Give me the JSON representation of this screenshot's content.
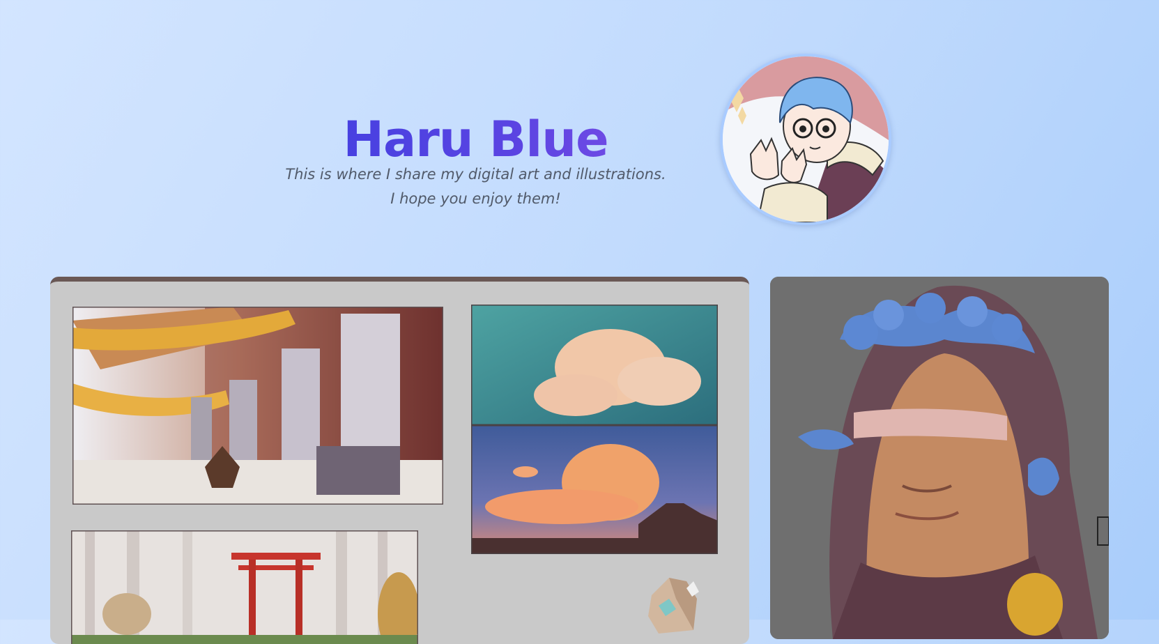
{
  "profile": {
    "name": "Haru Blue",
    "tagline_line1": "This is where I share my digital art and illustrations.",
    "tagline_line2": "I hope you enjoy them!"
  },
  "avatar": {
    "icon": "avatar-portrait-icon"
  },
  "gallery": {
    "featured": [
      {
        "name": "artwork-temple-guardians",
        "icon": "illustration"
      },
      {
        "name": "artwork-sky-studies",
        "icon": "illustration"
      },
      {
        "name": "artwork-torii-gate-forest",
        "icon": "illustration"
      },
      {
        "name": "artwork-crystal-rock",
        "icon": "illustration"
      }
    ],
    "side": {
      "name": "artwork-hooded-medusa",
      "icon": "illustration"
    }
  },
  "colors": {
    "title_gradient_start": "#3f3fe0",
    "title_gradient_end": "#7d4fe6",
    "page_background": "#c0dafd",
    "avatar_border": "#a9cbff"
  }
}
